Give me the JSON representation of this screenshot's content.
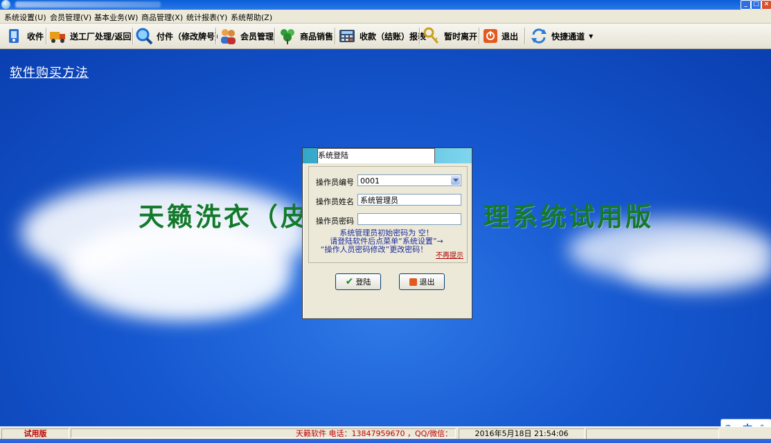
{
  "window": {
    "controls": {
      "minimize": "_",
      "maximize": "□",
      "close": "×"
    }
  },
  "menu": [
    "系统设置(U)",
    "会员管理(V)",
    "基本业务(W)",
    "商品管理(X)",
    "统计报表(Y)",
    "系统帮助(Z)"
  ],
  "toolbar": {
    "receive": "收件",
    "factory": "送工厂处理/返回",
    "pickup": "付件（修改牌号）",
    "members": "会员管理",
    "sales": "商品销售",
    "checkout": "收款（结账）报表",
    "away": "暂时离开",
    "exit": "退出",
    "shortcut": "快捷通道"
  },
  "desktop": {
    "buy_link": "软件购买方法",
    "title_left": "天籁洗衣（皮",
    "title_right": "理系统试用版"
  },
  "login": {
    "title": "系统登陆",
    "operator_id_label": "操作员编号",
    "operator_id_value": "0001",
    "operator_name_label": "操作员姓名",
    "operator_name_value": "系统管理员",
    "password_label": "操作员密码",
    "password_value": "",
    "hint_line1": "系统管理员初始密码为 空！",
    "hint_line2": "请登陆软件后点菜单“系统设置”→",
    "hint_line3": "“操作人员密码修改”更改密码！",
    "no_more_hint": "不再提示",
    "login_button": "登陆",
    "exit_button": "退出"
  },
  "status": {
    "trial": "试用版",
    "vendor": "天籁软件  电话：13847959670 ，QQ/微信：",
    "datetime": "2016年5月18日  21:54:06"
  },
  "ime": {
    "mode": "中"
  },
  "colors": {
    "desktop_blue": "#1658d0",
    "title_green": "#127a2a",
    "status_red": "#c00000"
  }
}
